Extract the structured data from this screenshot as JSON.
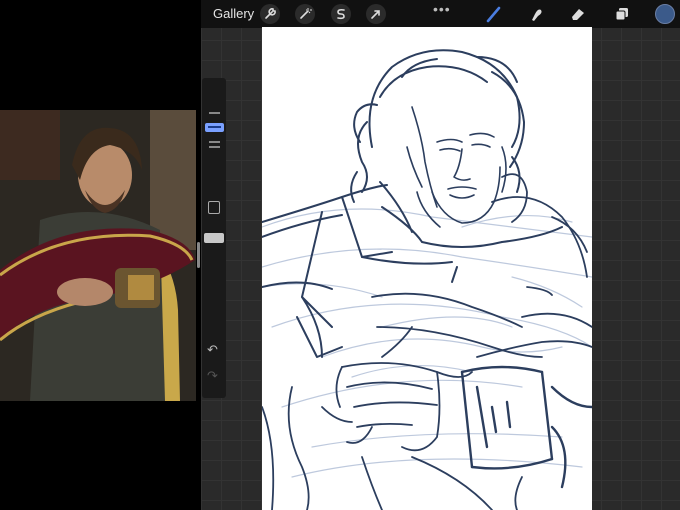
{
  "topbar": {
    "gallery_label": "Gallery",
    "actions_icon": "wrench-icon",
    "adjustments_icon": "magic-wand-icon",
    "selection_icon": "selection-s-icon",
    "transform_icon": "cursor-arrow-icon",
    "more_label": "•••",
    "brush_icon": "brush-icon",
    "smudge_icon": "smudge-icon",
    "eraser_icon": "eraser-icon",
    "layers_icon": "layers-icon",
    "current_color": "#3b5a8a"
  },
  "sidebar": {
    "undo_label": "↶",
    "redo_label": "↷"
  },
  "colors": {
    "active_tool": "#4a7de0",
    "sketch_ink": "#2c3e5e",
    "sketch_light": "#a9b9d4"
  }
}
